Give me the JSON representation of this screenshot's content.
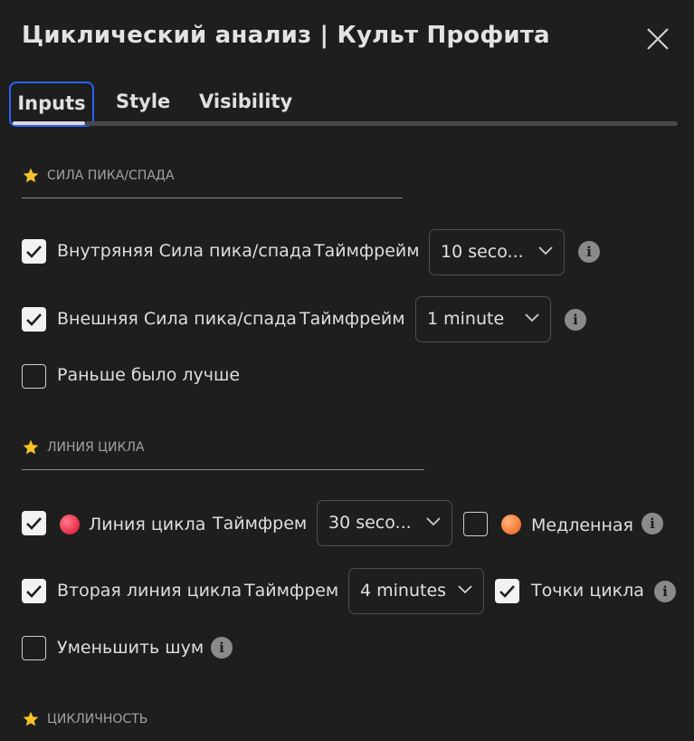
{
  "dialog": {
    "title": "Циклический анализ | Культ Профита"
  },
  "tabs": [
    {
      "label": "Inputs",
      "active": true
    },
    {
      "label": "Style",
      "active": false
    },
    {
      "label": "Visibility",
      "active": false
    }
  ],
  "sections": {
    "peak": {
      "title": "СИЛА ПИКА/СПАДА",
      "inner": {
        "checked": true,
        "label": "Внутряняя Сила пика/спада",
        "tf_label": "Таймфрейм",
        "value": "10 seco..."
      },
      "outer": {
        "checked": true,
        "label": "Внешняя Сила пика/спада",
        "tf_label": "Таймфрейм",
        "value": "1 minute"
      },
      "earlier": {
        "checked": false,
        "label": "Раньше было лучше"
      }
    },
    "cycle": {
      "title": "ЛИНИЯ ЦИКЛА",
      "line": {
        "checked": true,
        "label": "Линия цикла",
        "tf_label": "Таймфрем",
        "value": "30 seco...",
        "color": "#e8384f"
      },
      "slow": {
        "checked": false,
        "label": "Медленная",
        "color": "#f5803e"
      },
      "second": {
        "checked": true,
        "label": "Вторая линия цикла",
        "tf_label": "Таймфрем",
        "value": "4 minutes"
      },
      "points": {
        "checked": true,
        "label": "Точки цикла"
      },
      "noise": {
        "checked": false,
        "label": "Уменьшить шум"
      }
    },
    "cyclicity": {
      "title": "ЦИКЛИЧНОСТЬ"
    }
  },
  "colors": {
    "accent": "#2962ff",
    "star": "#f7c325",
    "background": "#1e1e1e"
  }
}
